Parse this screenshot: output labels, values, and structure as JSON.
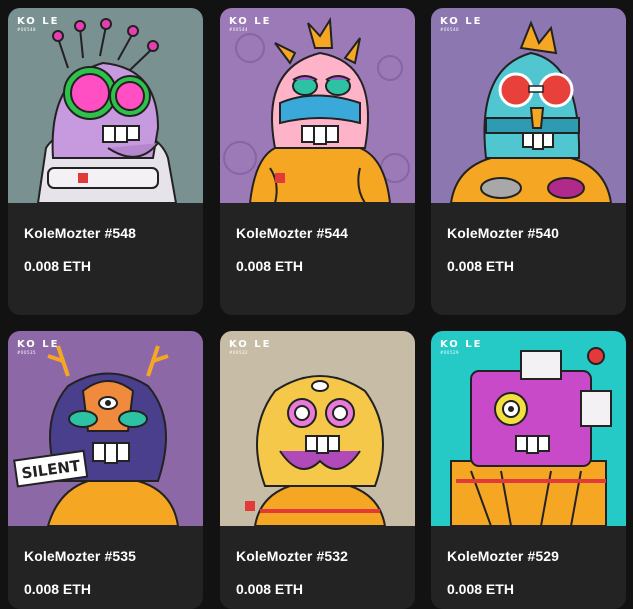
{
  "logo_text": "KO LE",
  "cards": [
    {
      "title": "KoleMozter #548",
      "price": "0.008 ETH",
      "bg": "#7a9191",
      "art_id": "#00548"
    },
    {
      "title": "KoleMozter #544",
      "price": "0.008 ETH",
      "bg": "#9c7ab8",
      "art_id": "#00544"
    },
    {
      "title": "KoleMozter #540",
      "price": "0.008 ETH",
      "bg": "#8c77b0",
      "art_id": "#00540"
    },
    {
      "title": "KoleMozter #535",
      "price": "0.008 ETH",
      "bg": "#8c69a6",
      "art_id": "#00535",
      "sign_text": "SILENT"
    },
    {
      "title": "KoleMozter #532",
      "price": "0.008 ETH",
      "bg": "#c7bca6",
      "art_id": "#00532"
    },
    {
      "title": "KoleMozter #529",
      "price": "0.008 ETH",
      "bg": "#25c9c6",
      "art_id": "#00529"
    }
  ]
}
